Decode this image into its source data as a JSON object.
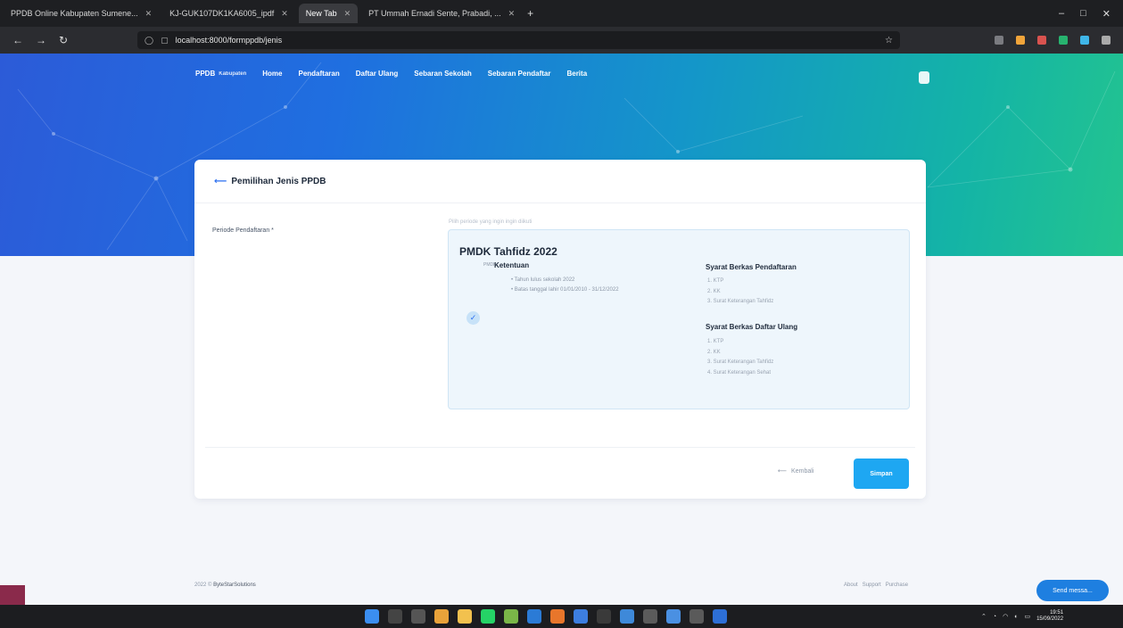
{
  "browser": {
    "tabs": [
      {
        "label": "PPDB Online Kabupaten Sumene...",
        "active": false
      },
      {
        "label": "KJ-GUK107DK1KA6005_ipdf",
        "active": false
      },
      {
        "label": "New Tab",
        "active": true
      },
      {
        "label": "PT Ummah Ernadi Sente, Prabadi, ...",
        "active": false
      }
    ],
    "url": "localhost:8000/formppdb/jenis",
    "window_controls": [
      "–",
      "□",
      "✕"
    ]
  },
  "site": {
    "logo_title": "PPDB",
    "logo_subtitle": "Kabupaten",
    "nav": [
      "Home",
      "Pendaftaran",
      "Daftar Ulang",
      "Sebaran Sekolah",
      "Sebaran Pendaftar",
      "Berita"
    ]
  },
  "form": {
    "title": "Pemilihan Jenis PPDB",
    "field_label": "Periode Pendaftaran *",
    "field_hint": "Pilih periode yang ingin ingin diikuti",
    "option": {
      "title": "PMDK Tahfidz 2022",
      "ket_tag": "PMDK",
      "ketentuan_title": "Ketentuan",
      "ketentuan": [
        "Tahun lulus sekolah 2022",
        "Batas tanggal lahir 01/01/2010 - 31/12/2022"
      ],
      "syarat_pendaftaran_title": "Syarat Berkas Pendaftaran",
      "syarat_pendaftaran": [
        "1. KTP",
        "2. KK",
        "3. Surat Keterangan Tahfidz"
      ],
      "syarat_daftar_ulang_title": "Syarat Berkas Daftar Ulang",
      "syarat_daftar_ulang": [
        "1. KTP",
        "2. KK",
        "3. Surat Keterangan Tahfidz",
        "4. Surat Keterangan Sehat"
      ]
    },
    "back_label": "Kembali",
    "save_label": "Simpan"
  },
  "footer": {
    "copyright": "2022 ©",
    "brand": "ByteStarSolutions",
    "links": [
      "About",
      "Support",
      "Purchase"
    ]
  },
  "chat": {
    "label": "Send messa..."
  },
  "taskbar": {
    "time": "19:51",
    "date": "15/09/2022"
  }
}
